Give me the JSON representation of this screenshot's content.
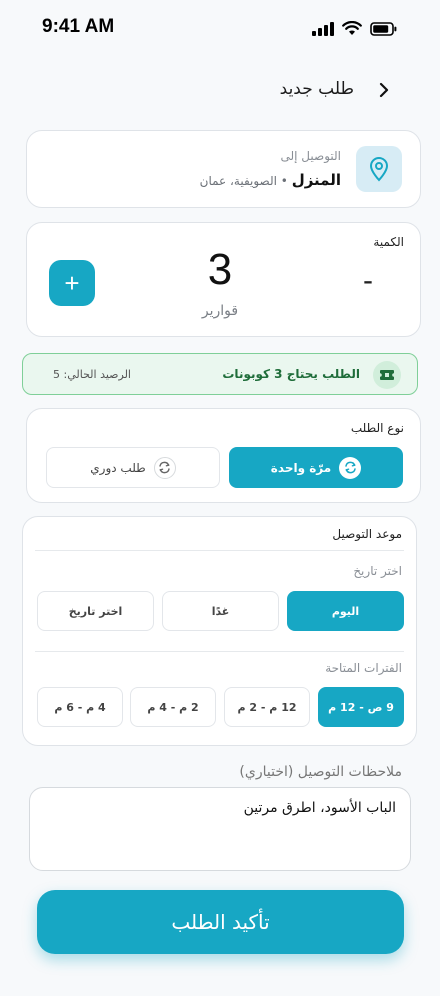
{
  "status_bar": {
    "time": "9:41 AM",
    "icons": [
      "signal-icon",
      "wifi-icon",
      "battery-icon"
    ]
  },
  "header": {
    "title": "طلب جديد",
    "back_icon": "chevron-right-icon"
  },
  "location": {
    "label": "التوصيل إلى",
    "name": "المنزل",
    "separator": " • ",
    "address": "الصويفية، عمان",
    "icon": "location-pin-icon"
  },
  "quantity": {
    "label": "الكمية",
    "value": "3",
    "unit": "قوارير",
    "minus_label": "-",
    "plus_label": "+"
  },
  "coupon": {
    "message": "الطلب يحتاج 3 كوبونات",
    "balance": "الرصيد الحالي: 5",
    "icon": "ticket-icon"
  },
  "order_type": {
    "label": "نوع الطلب",
    "options": [
      {
        "label": "مرّة واحدة",
        "selected": true,
        "icon": "repeat-icon"
      },
      {
        "label": "طلب دوري",
        "selected": false,
        "icon": "repeat-icon"
      }
    ]
  },
  "delivery": {
    "label": "موعد التوصيل",
    "date_label": "اختر تاريخ",
    "dates": [
      {
        "label": "اليوم",
        "selected": true
      },
      {
        "label": "غدًا",
        "selected": false
      },
      {
        "label": "اختر تاريخ",
        "selected": false
      }
    ],
    "slots_label": "الفترات المتاحة",
    "slots": [
      {
        "label": "9 ص - 12 م",
        "selected": true
      },
      {
        "label": "12 م - 2 م",
        "selected": false
      },
      {
        "label": "2 م - 4 م",
        "selected": false
      },
      {
        "label": "4 م - 6 م",
        "selected": false
      }
    ]
  },
  "notes": {
    "label": "ملاحظات التوصيل (اختياري)",
    "value": "الباب الأسود، اطرق مرتين"
  },
  "confirm": {
    "label": "تأكيد الطلب"
  },
  "colors": {
    "accent": "#17a7c4",
    "success_bg": "#eaf7ef",
    "success_border": "#7fcf98",
    "success_text": "#1f6d3a"
  }
}
